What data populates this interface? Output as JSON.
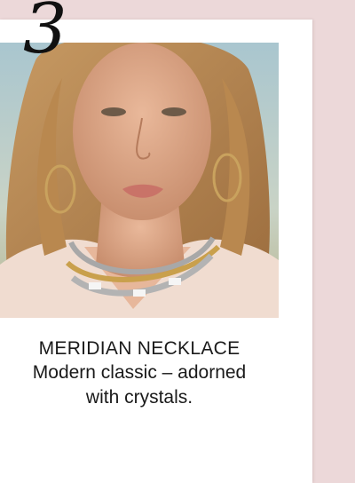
{
  "step": {
    "number": "3"
  },
  "product": {
    "image_icon": "model-wearing-necklace-photo",
    "title": "MERIDIAN NECKLACE",
    "description": "Modern classic – adorned with crystals."
  },
  "colors": {
    "background": "#ecd8d9",
    "card": "#ffffff",
    "text": "#1a1a1a"
  }
}
